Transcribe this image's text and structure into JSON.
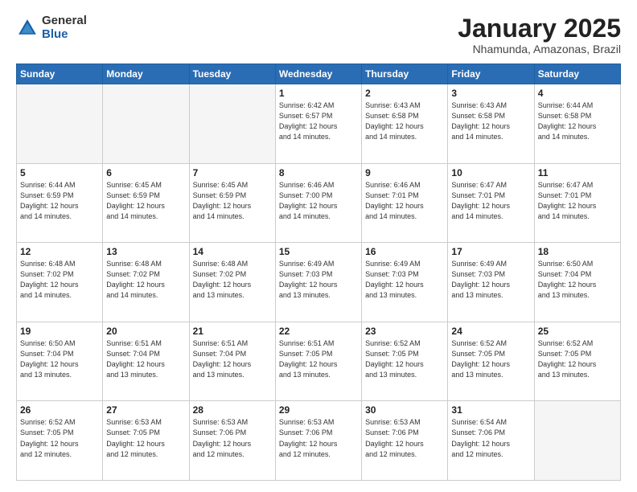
{
  "header": {
    "logo_general": "General",
    "logo_blue": "Blue",
    "title": "January 2025",
    "subtitle": "Nhamunda, Amazonas, Brazil"
  },
  "weekdays": [
    "Sunday",
    "Monday",
    "Tuesday",
    "Wednesday",
    "Thursday",
    "Friday",
    "Saturday"
  ],
  "weeks": [
    [
      {
        "day": "",
        "info": ""
      },
      {
        "day": "",
        "info": ""
      },
      {
        "day": "",
        "info": ""
      },
      {
        "day": "1",
        "info": "Sunrise: 6:42 AM\nSunset: 6:57 PM\nDaylight: 12 hours\nand 14 minutes."
      },
      {
        "day": "2",
        "info": "Sunrise: 6:43 AM\nSunset: 6:58 PM\nDaylight: 12 hours\nand 14 minutes."
      },
      {
        "day": "3",
        "info": "Sunrise: 6:43 AM\nSunset: 6:58 PM\nDaylight: 12 hours\nand 14 minutes."
      },
      {
        "day": "4",
        "info": "Sunrise: 6:44 AM\nSunset: 6:58 PM\nDaylight: 12 hours\nand 14 minutes."
      }
    ],
    [
      {
        "day": "5",
        "info": "Sunrise: 6:44 AM\nSunset: 6:59 PM\nDaylight: 12 hours\nand 14 minutes."
      },
      {
        "day": "6",
        "info": "Sunrise: 6:45 AM\nSunset: 6:59 PM\nDaylight: 12 hours\nand 14 minutes."
      },
      {
        "day": "7",
        "info": "Sunrise: 6:45 AM\nSunset: 6:59 PM\nDaylight: 12 hours\nand 14 minutes."
      },
      {
        "day": "8",
        "info": "Sunrise: 6:46 AM\nSunset: 7:00 PM\nDaylight: 12 hours\nand 14 minutes."
      },
      {
        "day": "9",
        "info": "Sunrise: 6:46 AM\nSunset: 7:01 PM\nDaylight: 12 hours\nand 14 minutes."
      },
      {
        "day": "10",
        "info": "Sunrise: 6:47 AM\nSunset: 7:01 PM\nDaylight: 12 hours\nand 14 minutes."
      },
      {
        "day": "11",
        "info": "Sunrise: 6:47 AM\nSunset: 7:01 PM\nDaylight: 12 hours\nand 14 minutes."
      }
    ],
    [
      {
        "day": "12",
        "info": "Sunrise: 6:48 AM\nSunset: 7:02 PM\nDaylight: 12 hours\nand 14 minutes."
      },
      {
        "day": "13",
        "info": "Sunrise: 6:48 AM\nSunset: 7:02 PM\nDaylight: 12 hours\nand 14 minutes."
      },
      {
        "day": "14",
        "info": "Sunrise: 6:48 AM\nSunset: 7:02 PM\nDaylight: 12 hours\nand 13 minutes."
      },
      {
        "day": "15",
        "info": "Sunrise: 6:49 AM\nSunset: 7:03 PM\nDaylight: 12 hours\nand 13 minutes."
      },
      {
        "day": "16",
        "info": "Sunrise: 6:49 AM\nSunset: 7:03 PM\nDaylight: 12 hours\nand 13 minutes."
      },
      {
        "day": "17",
        "info": "Sunrise: 6:49 AM\nSunset: 7:03 PM\nDaylight: 12 hours\nand 13 minutes."
      },
      {
        "day": "18",
        "info": "Sunrise: 6:50 AM\nSunset: 7:04 PM\nDaylight: 12 hours\nand 13 minutes."
      }
    ],
    [
      {
        "day": "19",
        "info": "Sunrise: 6:50 AM\nSunset: 7:04 PM\nDaylight: 12 hours\nand 13 minutes."
      },
      {
        "day": "20",
        "info": "Sunrise: 6:51 AM\nSunset: 7:04 PM\nDaylight: 12 hours\nand 13 minutes."
      },
      {
        "day": "21",
        "info": "Sunrise: 6:51 AM\nSunset: 7:04 PM\nDaylight: 12 hours\nand 13 minutes."
      },
      {
        "day": "22",
        "info": "Sunrise: 6:51 AM\nSunset: 7:05 PM\nDaylight: 12 hours\nand 13 minutes."
      },
      {
        "day": "23",
        "info": "Sunrise: 6:52 AM\nSunset: 7:05 PM\nDaylight: 12 hours\nand 13 minutes."
      },
      {
        "day": "24",
        "info": "Sunrise: 6:52 AM\nSunset: 7:05 PM\nDaylight: 12 hours\nand 13 minutes."
      },
      {
        "day": "25",
        "info": "Sunrise: 6:52 AM\nSunset: 7:05 PM\nDaylight: 12 hours\nand 13 minutes."
      }
    ],
    [
      {
        "day": "26",
        "info": "Sunrise: 6:52 AM\nSunset: 7:05 PM\nDaylight: 12 hours\nand 12 minutes."
      },
      {
        "day": "27",
        "info": "Sunrise: 6:53 AM\nSunset: 7:05 PM\nDaylight: 12 hours\nand 12 minutes."
      },
      {
        "day": "28",
        "info": "Sunrise: 6:53 AM\nSunset: 7:06 PM\nDaylight: 12 hours\nand 12 minutes."
      },
      {
        "day": "29",
        "info": "Sunrise: 6:53 AM\nSunset: 7:06 PM\nDaylight: 12 hours\nand 12 minutes."
      },
      {
        "day": "30",
        "info": "Sunrise: 6:53 AM\nSunset: 7:06 PM\nDaylight: 12 hours\nand 12 minutes."
      },
      {
        "day": "31",
        "info": "Sunrise: 6:54 AM\nSunset: 7:06 PM\nDaylight: 12 hours\nand 12 minutes."
      },
      {
        "day": "",
        "info": ""
      }
    ]
  ]
}
